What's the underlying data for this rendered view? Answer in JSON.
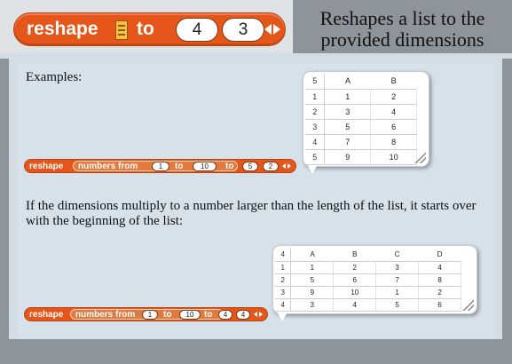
{
  "header": {
    "block": {
      "keyword": "reshape",
      "to_label": "to",
      "dim1": "4",
      "dim2": "3"
    },
    "description": "Reshapes a list to the provided dimensions"
  },
  "examples_label": "Examples:",
  "example1": {
    "block": {
      "keyword": "reshape",
      "numbers_label": "numbers from",
      "from": "1",
      "to_label": "to",
      "to": "10",
      "outer_to_label": "to",
      "dim1": "5",
      "dim2": "2"
    },
    "table": {
      "corner": "5",
      "columns": [
        "A",
        "B"
      ],
      "rows": [
        {
          "index": "1",
          "cells": [
            "1",
            "2"
          ]
        },
        {
          "index": "2",
          "cells": [
            "3",
            "4"
          ]
        },
        {
          "index": "3",
          "cells": [
            "5",
            "6"
          ]
        },
        {
          "index": "4",
          "cells": [
            "7",
            "8"
          ]
        },
        {
          "index": "5",
          "cells": [
            "9",
            "10"
          ]
        }
      ]
    }
  },
  "paragraph": "If the dimensions multiply to a number larger than the length of the list, it starts over with the beginning of the list:",
  "example2": {
    "block": {
      "keyword": "reshape",
      "numbers_label": "numbers from",
      "from": "1",
      "to_label": "to",
      "to": "10",
      "outer_to_label": "to",
      "dim1": "4",
      "dim2": "4"
    },
    "table": {
      "corner": "4",
      "columns": [
        "A",
        "B",
        "C",
        "D"
      ],
      "rows": [
        {
          "index": "1",
          "cells": [
            "1",
            "2",
            "3",
            "4"
          ]
        },
        {
          "index": "2",
          "cells": [
            "5",
            "6",
            "7",
            "8"
          ]
        },
        {
          "index": "3",
          "cells": [
            "9",
            "10",
            "1",
            "2"
          ]
        },
        {
          "index": "4",
          "cells": [
            "3",
            "4",
            "5",
            "6"
          ]
        }
      ]
    }
  },
  "colors": {
    "block_orange": "#e4561a",
    "background_gray": "#8e959a",
    "panel_blue": "#d3dde6"
  }
}
